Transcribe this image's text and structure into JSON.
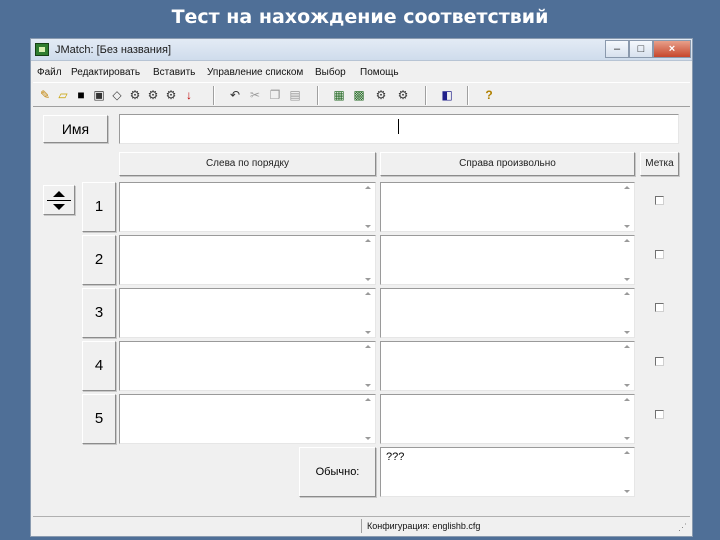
{
  "slide": {
    "title": "Тест на нахождение соответствий"
  },
  "window": {
    "title": "JMatch: [Без названия]",
    "controls": {
      "minimize": "–",
      "maximize": "□",
      "close": "×"
    }
  },
  "menu": [
    "Файл",
    "Редактировать",
    "Вставить",
    "Управление списком",
    "Выбор",
    "Помощь"
  ],
  "toolbar": [
    "new-icon",
    "open-icon",
    "save-icon",
    "save-as-icon",
    "clear-icon",
    "export-icon",
    "web-icon",
    "download-icon",
    "undo-icon",
    "cut-icon",
    "copy-icon",
    "paste-icon",
    "config-icon",
    "export-web-icon",
    "export-hot-icon",
    "export-java-icon",
    "addtext-icon",
    "help-icon"
  ],
  "form": {
    "name_label": "Имя",
    "name_value": "",
    "header_left": "Слева по порядку",
    "header_right": "Справа произвольно",
    "header_mark": "Метка",
    "rows": [
      {
        "num": "1",
        "left": "",
        "right": ""
      },
      {
        "num": "2",
        "left": "",
        "right": ""
      },
      {
        "num": "3",
        "left": "",
        "right": ""
      },
      {
        "num": "4",
        "left": "",
        "right": ""
      },
      {
        "num": "5",
        "left": "",
        "right": ""
      }
    ],
    "default_label": "Обычно:",
    "default_value": "???"
  },
  "status": {
    "config": "Конфигурация: englishb.cfg"
  }
}
